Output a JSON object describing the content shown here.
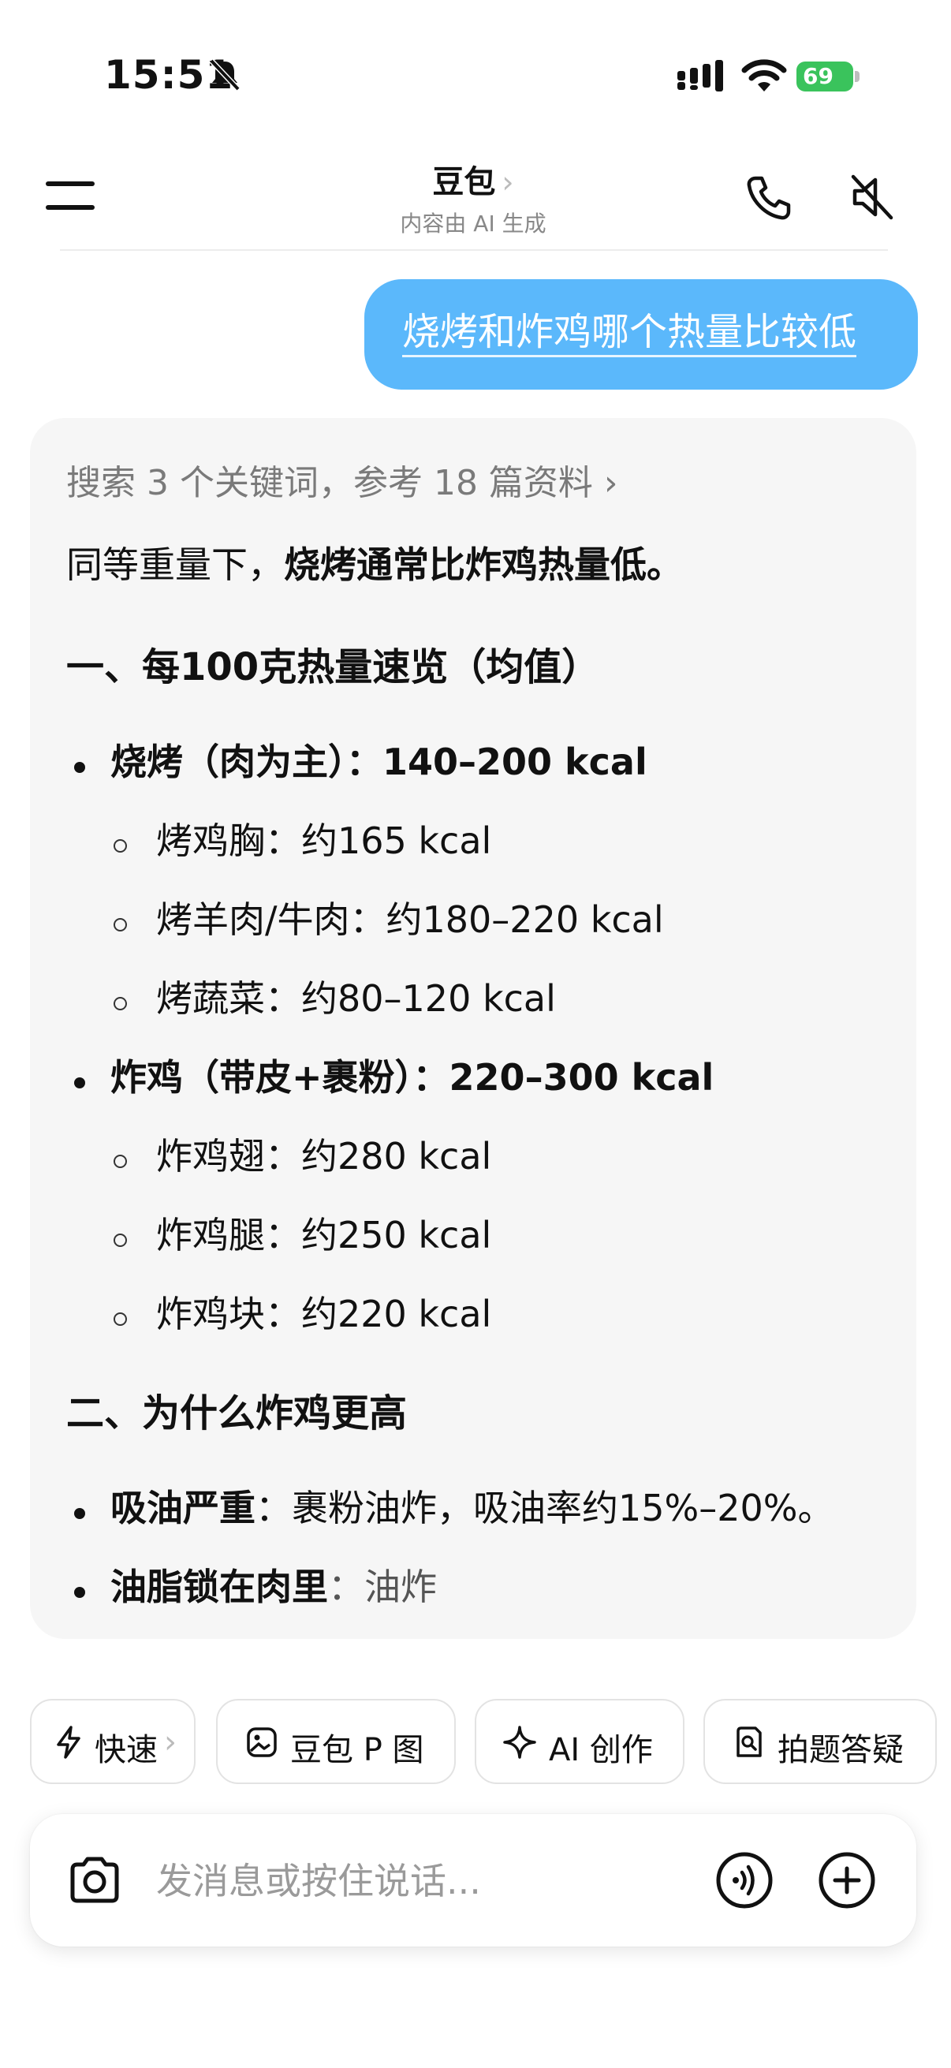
{
  "status_bar": {
    "time": "15:51",
    "battery": "69",
    "battery_color": "#3ac35c"
  },
  "header": {
    "title": "豆包",
    "title_chevron": "›",
    "subtitle": "内容由 AI 生成",
    "icons": [
      "menu-icon",
      "phone-icon",
      "speaker-mute-icon"
    ]
  },
  "user_message": "烧烤和炸鸡哪个热量比较低",
  "answer": {
    "search_summary": "搜索 3 个关键词，参考 18 篇资料 ›",
    "intro": "同等重量下，",
    "intro_bold": "烧烤通常比炸鸡热量低。",
    "section1_title": "一、每100克热量速览（均值）",
    "groups": [
      {
        "label": "烧烤（肉为主）：",
        "value": "140–200 kcal",
        "items": [
          "烤鸡胸：约165 kcal",
          "烤羊肉/牛肉：约180–220 kcal",
          "烤蔬菜：约80–120 kcal"
        ]
      },
      {
        "label": "炸鸡（带皮+裹粉）：",
        "value": "220–300 kcal",
        "items": [
          "炸鸡翅：约280 kcal",
          "炸鸡腿：约250 kcal",
          "炸鸡块：约220 kcal"
        ]
      }
    ],
    "section2_title": "二、为什么炸鸡更高",
    "reasons": [
      {
        "label": "吸油严重",
        "text": "：裹粉油炸，吸油率约15%–20%。"
      },
      {
        "label": "油脂锁在肉里",
        "text": "：油炸"
      }
    ]
  },
  "chips": [
    {
      "label": "快速",
      "suffix": "›",
      "icon": "lightning-icon"
    },
    {
      "label": "豆包 P 图",
      "icon": "image-edit-icon"
    },
    {
      "label": "AI 创作",
      "icon": "sparkle-icon"
    },
    {
      "label": "拍题答疑",
      "icon": "search-doc-icon"
    }
  ],
  "input": {
    "placeholder": "发消息或按住说话...",
    "icons": [
      "camera-icon",
      "voice-icon",
      "plus-icon"
    ]
  },
  "colors": {
    "user_bubble": "#5bb8fb",
    "card_bg": "#f6f6f6"
  }
}
